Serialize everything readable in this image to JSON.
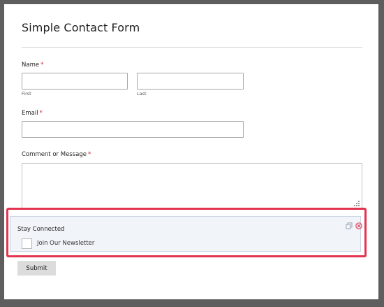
{
  "form": {
    "title": "Simple Contact Form",
    "name": {
      "label": "Name",
      "required_mark": "*",
      "first_sublabel": "First",
      "last_sublabel": "Last",
      "first_value": "",
      "last_value": ""
    },
    "email": {
      "label": "Email",
      "required_mark": "*",
      "value": ""
    },
    "message": {
      "label": "Comment or Message",
      "required_mark": "*",
      "value": ""
    },
    "stay_connected": {
      "title": "Stay Connected",
      "checkbox_label": "Join Our Newsletter",
      "checked": false,
      "icons": [
        "duplicate-icon",
        "delete-icon"
      ]
    },
    "submit_label": "Submit"
  },
  "colors": {
    "highlight_border": "#e3344f",
    "required": "#d4202f",
    "section_background": "#f1f4f9"
  }
}
